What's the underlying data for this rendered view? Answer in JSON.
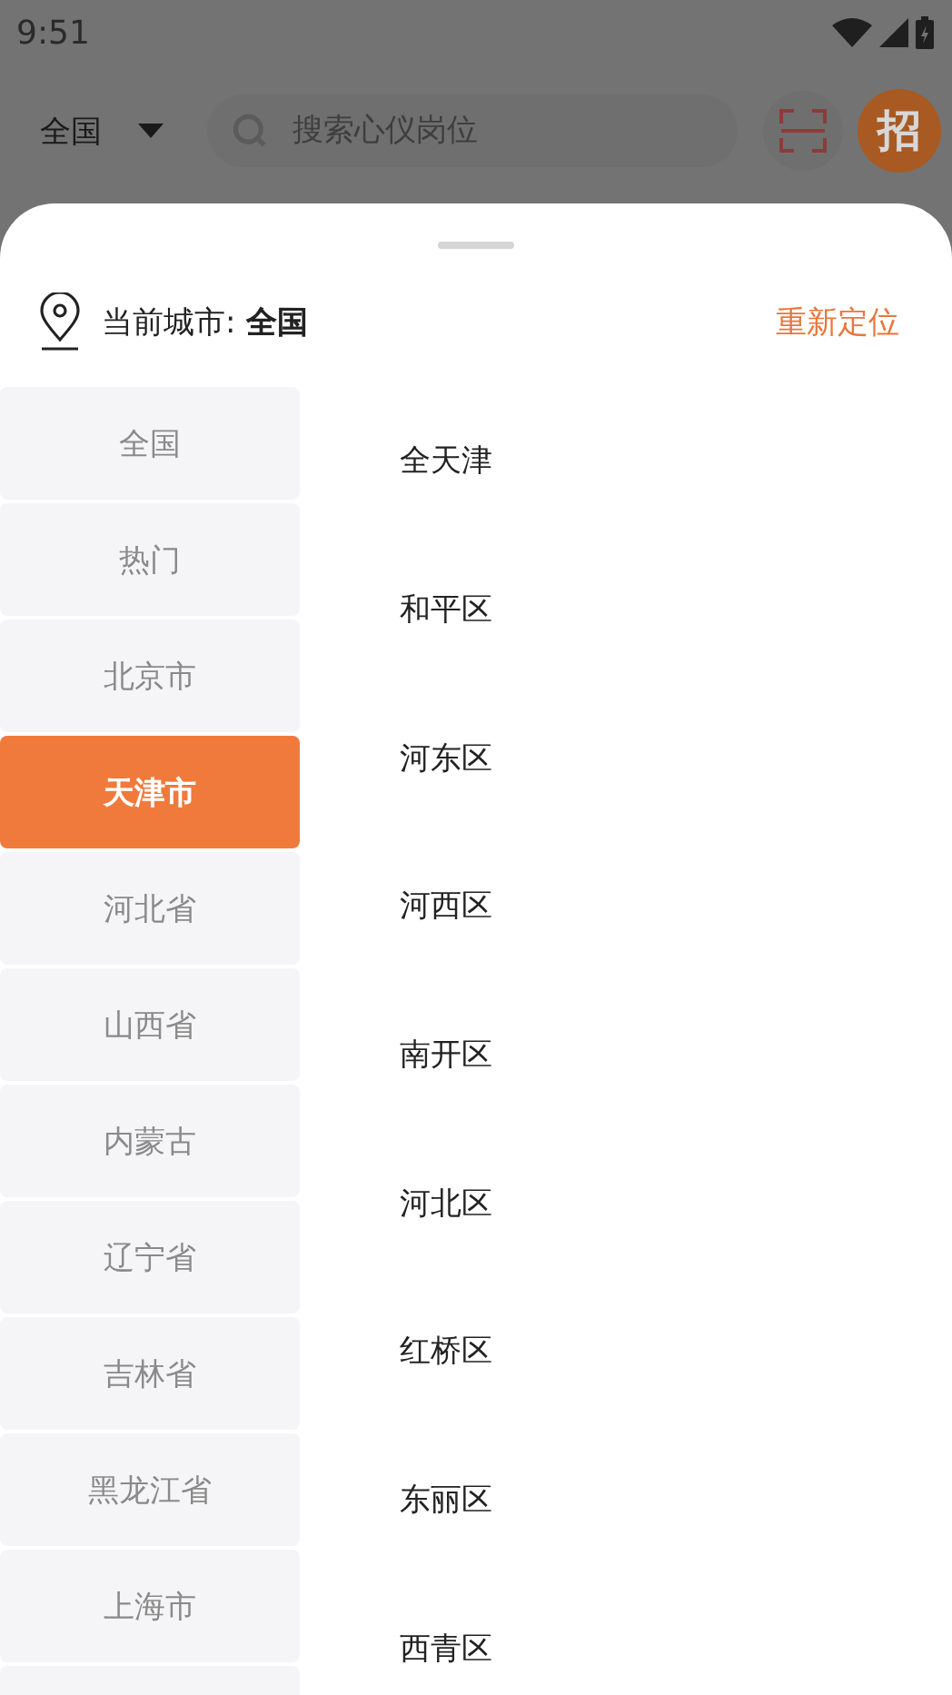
{
  "status_bar": {
    "time": "9:51"
  },
  "top_bar": {
    "region": "全国",
    "search": {
      "placeholder": "搜索心仪岗位"
    },
    "badge": "招"
  },
  "sheet": {
    "current_label": "当前城市:",
    "current_city": "全国",
    "relocate": "重新定位",
    "provinces": [
      {
        "name": "全国",
        "selected": false
      },
      {
        "name": "热门",
        "selected": false
      },
      {
        "name": "北京市",
        "selected": false
      },
      {
        "name": "天津市",
        "selected": true
      },
      {
        "name": "河北省",
        "selected": false
      },
      {
        "name": "山西省",
        "selected": false
      },
      {
        "name": "内蒙古",
        "selected": false
      },
      {
        "name": "辽宁省",
        "selected": false
      },
      {
        "name": "吉林省",
        "selected": false
      },
      {
        "name": "黑龙江省",
        "selected": false
      },
      {
        "name": "上海市",
        "selected": false
      }
    ],
    "districts": [
      "全天津",
      "和平区",
      "河东区",
      "河西区",
      "南开区",
      "河北区",
      "红桥区",
      "东丽区",
      "西青区"
    ]
  }
}
